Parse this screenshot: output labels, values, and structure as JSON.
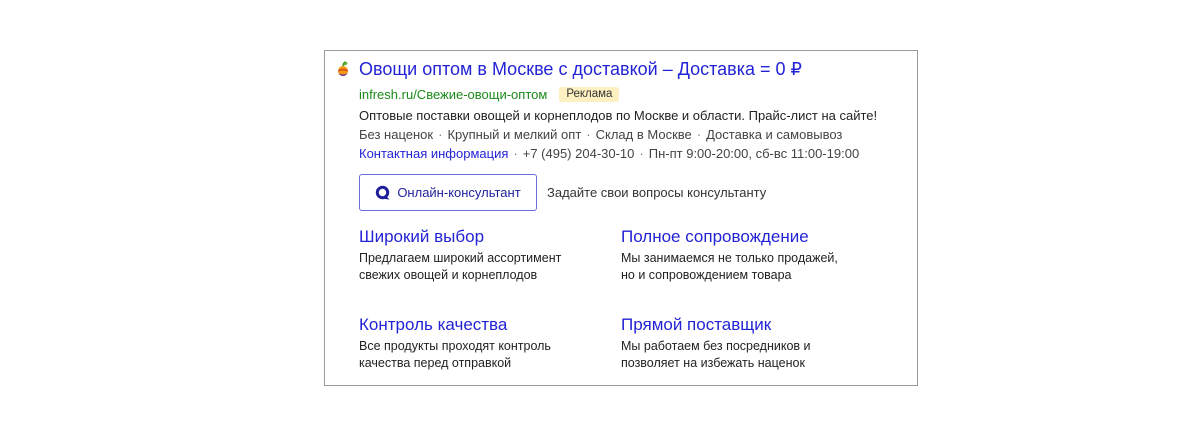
{
  "ad": {
    "title": "Овощи оптом в Москве с доставкой – Доставка = 0 ₽",
    "url": "infresh.ru/Свежие-овощи-оптом",
    "badge": "Реклама",
    "description": "Оптовые поставки овощей и корнеплодов по Москве и области. Прайс-лист на сайте!",
    "features": [
      "Без наценок",
      "Крупный и мелкий опт",
      "Склад в Москве",
      "Доставка и самовывоз"
    ],
    "contacts": {
      "link": "Контактная информация",
      "phone": "+7 (495) 204-30-10",
      "hours": "Пн-пт 9:00-20:00, сб-вс 11:00-19:00"
    },
    "consultant": {
      "button_label": "Онлайн-консультант",
      "hint": "Задайте свои вопросы консультанту"
    },
    "sitelinks": [
      {
        "title": "Широкий выбор",
        "desc": "Предлагаем широкий ассортимент свежих овощей и корнеплодов"
      },
      {
        "title": "Полное сопровождение",
        "desc": "Мы занимаемся не только продажей, но и сопровождением товара"
      },
      {
        "title": "Контроль качества",
        "desc": "Все продукты проходят контроль качества перед отправкой"
      },
      {
        "title": "Прямой поставщик",
        "desc": "Мы работаем без посредников и позволяет на избежать наценок"
      }
    ]
  },
  "colors": {
    "link": "#2323d6",
    "url": "#1b8a1b",
    "badge_bg": "#fff0c2",
    "border": "#9a9a9a"
  },
  "icons": {
    "favicon": "fruit-icon",
    "consultant": "chat-bubble-icon"
  }
}
